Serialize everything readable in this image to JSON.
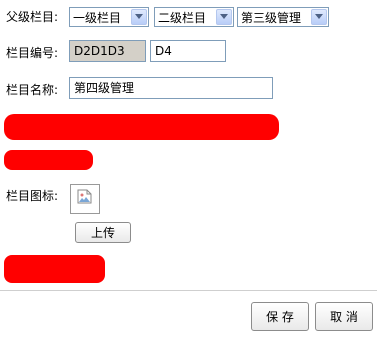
{
  "parent_column": {
    "label": "父级栏目:",
    "level1_selected": "一级栏目",
    "level2_selected": "二级栏目",
    "level3_selected": "第三级管理"
  },
  "column_code": {
    "label": "栏目编号:",
    "prefix_value": "D2D1D3",
    "suffix_value": "D4"
  },
  "column_name": {
    "label": "栏目名称:",
    "value": "第四级管理"
  },
  "column_icon": {
    "label": "栏目图标:",
    "upload_label": "上传"
  },
  "footer": {
    "save_label": "保 存",
    "cancel_label": "取 消"
  },
  "colors": {
    "redaction": "#ff0000",
    "readonly_bg": "#d4d0c8",
    "input_border": "#7f9db9"
  }
}
